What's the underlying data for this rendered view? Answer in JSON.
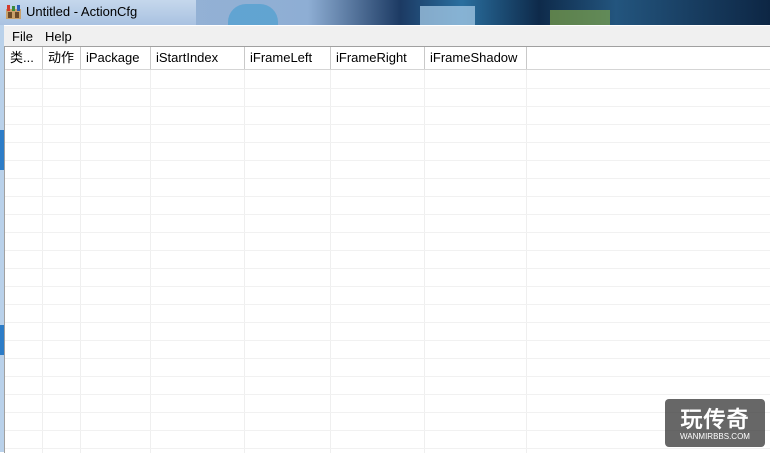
{
  "window": {
    "title": "Untitled - ActionCfg"
  },
  "menu": {
    "items": [
      "File",
      "Help"
    ]
  },
  "table": {
    "columns": [
      "类...",
      "动作",
      "iPackage",
      "iStartIndex",
      "iFrameLeft",
      "iFrameRight",
      "iFrameShadow"
    ],
    "rows": []
  },
  "watermark": {
    "main": "玩传奇",
    "sub": "WANMIRBBS.COM"
  },
  "colors": {
    "header_divider": "#c9c9c9",
    "grid": "#efefef",
    "menubar": "#f0f0f0"
  }
}
